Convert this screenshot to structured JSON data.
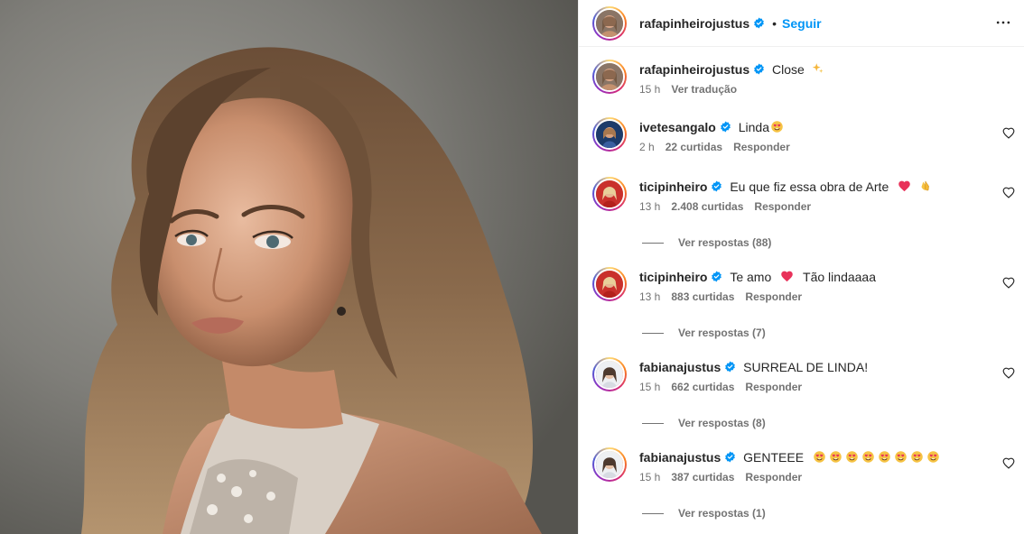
{
  "post": {
    "author": "rafapinheirojustus",
    "follow_label": "Seguir",
    "separator": "•"
  },
  "caption": {
    "user": "rafapinheirojustus",
    "text": "Close",
    "time": "15 h",
    "translate_label": "Ver tradução"
  },
  "comments": [
    {
      "user": "ivetesangalo",
      "text": "Linda",
      "time": "2 h",
      "likes": "22 curtidas",
      "reply_label": "Responder",
      "view_replies": ""
    },
    {
      "user": "ticipinheiro",
      "text": "Eu que fiz essa obra de Arte",
      "time": "13 h",
      "likes": "2.408 curtidas",
      "reply_label": "Responder",
      "view_replies": "Ver respostas (88)"
    },
    {
      "user": "ticipinheiro",
      "text": "Te amo",
      "text2": "Tão lindaaaa",
      "time": "13 h",
      "likes": "883 curtidas",
      "reply_label": "Responder",
      "view_replies": "Ver respostas (7)"
    },
    {
      "user": "fabianajustus",
      "text": "SURREAL DE LINDA!",
      "time": "15 h",
      "likes": "662 curtidas",
      "reply_label": "Responder",
      "view_replies": "Ver respostas (8)"
    },
    {
      "user": "fabianajustus",
      "text": "GENTEEE",
      "time": "15 h",
      "likes": "387 curtidas",
      "reply_label": "Responder",
      "view_replies": "Ver respostas (1)"
    }
  ],
  "icons": {
    "verified": "verified-badge-icon",
    "more": "more-options-icon",
    "like": "heart-outline-icon"
  },
  "colors": {
    "accent": "#0095f6",
    "text": "#262626",
    "muted": "#737373",
    "verified": "#0095f6"
  }
}
